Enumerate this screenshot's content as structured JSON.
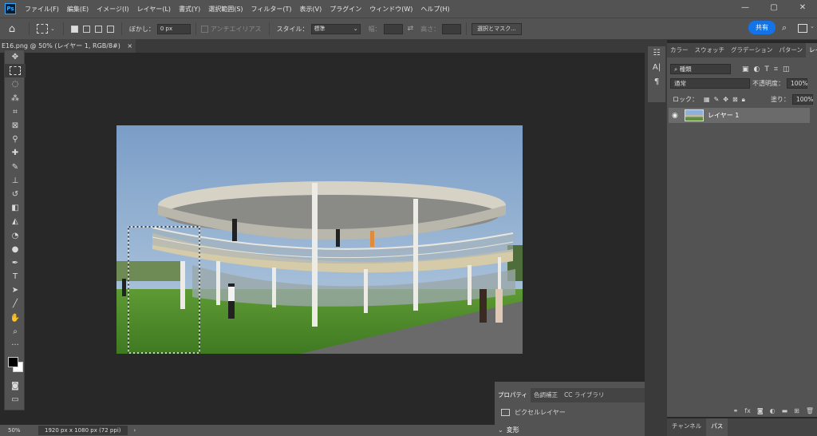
{
  "app": {
    "logo": "Ps"
  },
  "menu": [
    "ファイル(F)",
    "編集(E)",
    "イメージ(I)",
    "レイヤー(L)",
    "書式(Y)",
    "選択範囲(S)",
    "フィルター(T)",
    "表示(V)",
    "プラグイン",
    "ウィンドウ(W)",
    "ヘルプ(H)"
  ],
  "window_controls": {
    "minimize": "—",
    "restore": "▢",
    "close": "✕"
  },
  "options": {
    "feather_label": "ぼかし：",
    "feather_value": "0 px",
    "antialias_label": "アンチエイリアス",
    "style_label": "スタイル：",
    "style_value": "標準",
    "width_label": "幅：",
    "height_label": "高さ：",
    "select_mask_button": "選択とマスク...",
    "share_button": "共有"
  },
  "document": {
    "tab_title": "E16.png @ 50% (レイヤー 1, RGB/8#)",
    "tab_close": "×",
    "zoom": "50%",
    "doc_info": "1920 px x 1080 px (72 ppi)",
    "status_arrow": "›"
  },
  "layers_panel": {
    "tabs": [
      "カラー",
      "スウォッチ",
      "グラデーション",
      "パターン",
      "レイヤー"
    ],
    "active_tab": "レイヤー",
    "filter_label": "種類",
    "blend_mode": "通常",
    "opacity_label": "不透明度：",
    "opacity_value": "100%",
    "lock_label": "ロック：",
    "fill_label": "塗り：",
    "fill_value": "100%",
    "layers": [
      {
        "name": "レイヤー 1",
        "visible": true
      }
    ],
    "bottom_tabs": [
      "チャンネル",
      "パス"
    ]
  },
  "properties_panel": {
    "tabs": [
      "プロパティ",
      "色調補正",
      "CC ライブラリ"
    ],
    "active_tab": "プロパティ",
    "item": "ピクセルレイヤー",
    "section": "変形"
  },
  "colors": {
    "ui_dark": "#282828",
    "ui_panel": "#535353",
    "accent": "#1473e6",
    "ps_blue": "#31a8ff"
  }
}
